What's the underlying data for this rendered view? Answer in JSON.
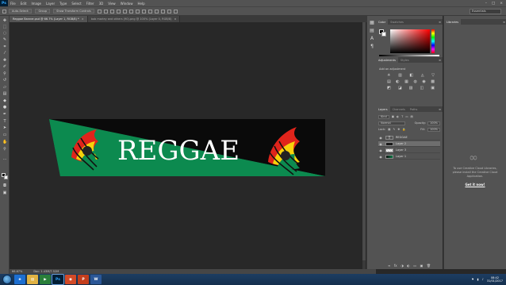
{
  "app": {
    "logo": "Ps",
    "menu": [
      "File",
      "Edit",
      "Image",
      "Layer",
      "Type",
      "Select",
      "Filter",
      "3D",
      "View",
      "Window",
      "Help"
    ],
    "window_controls": [
      "–",
      "□",
      "×"
    ]
  },
  "options_bar": {
    "auto_select_label": "Auto-Select:",
    "auto_select_value": "Group",
    "show_transform_label": "Show Transform Controls",
    "workspace": "Essentials"
  },
  "doc_tabs": [
    {
      "label": "Reggae Banner.psd @ 66.7% (Layer 1, RGB/8) *",
      "active": true
    },
    {
      "label": "bob marley and others (90).png @ 100% (Layer 0, RGB/8)",
      "active": false
    }
  ],
  "canvas": {
    "banner_text": "REGGAE",
    "colors": {
      "green": "#0c8a4f",
      "black": "#0a0a0a",
      "red": "#e0241b",
      "yellow": "#f6d20b"
    }
  },
  "status_bar": {
    "zoom": "66.67%",
    "doc_size": "Doc: 1.43M/7.52M"
  },
  "color_panel": {
    "tabs": [
      "Color",
      "Swatches"
    ]
  },
  "adjustments_panel": {
    "tabs": [
      "Adjustments",
      "Styles"
    ],
    "label": "Add an adjustment",
    "row1_icons": [
      "☀",
      "▥",
      "◧",
      "◬",
      "▽"
    ],
    "row2_icons": [
      "▤",
      "◐",
      "▦",
      "◍",
      "◉",
      "▩"
    ],
    "row3_icons": [
      "◩",
      "◪",
      "▨",
      "◫",
      "▣"
    ]
  },
  "layers_panel": {
    "tabs": [
      "Layers",
      "Channels",
      "Paths"
    ],
    "filter": "Kind",
    "blend_mode": "Normal",
    "opacity_label": "Opacity:",
    "opacity_value": "100%",
    "lock_label": "Lock:",
    "fill_label": "Fill:",
    "fill_value": "100%",
    "layers": [
      {
        "name": "REGGAE",
        "thumb": "text",
        "selected": false
      },
      {
        "name": "Layer 2",
        "thumb": "dark",
        "selected": true
      },
      {
        "name": "Layer 3",
        "thumb": "check",
        "selected": false
      },
      {
        "name": "Layer 1",
        "thumb": "green",
        "selected": false
      }
    ],
    "footer_icons": [
      "∞",
      "fx",
      "◑",
      "◐",
      "▭",
      "▣",
      "🗑"
    ]
  },
  "libraries_panel": {
    "tab": "Libraries",
    "message": "To use Creative Cloud Libraries, please install the Creative Cloud Application.",
    "link": "Get it now!"
  },
  "taskbar": {
    "apps": [
      {
        "label": "e",
        "color": "#1d6fd1"
      },
      {
        "label": "▤",
        "color": "#e0b243"
      },
      {
        "label": "▶",
        "color": "#2a7f3a"
      },
      {
        "label": "Ps",
        "color": "#001d34"
      },
      {
        "label": "◉",
        "color": "#d34a27"
      },
      {
        "label": "P",
        "color": "#c43e1c"
      },
      {
        "label": "W",
        "color": "#2b5797"
      }
    ],
    "time": "08:42",
    "date": "31/01/2017"
  }
}
